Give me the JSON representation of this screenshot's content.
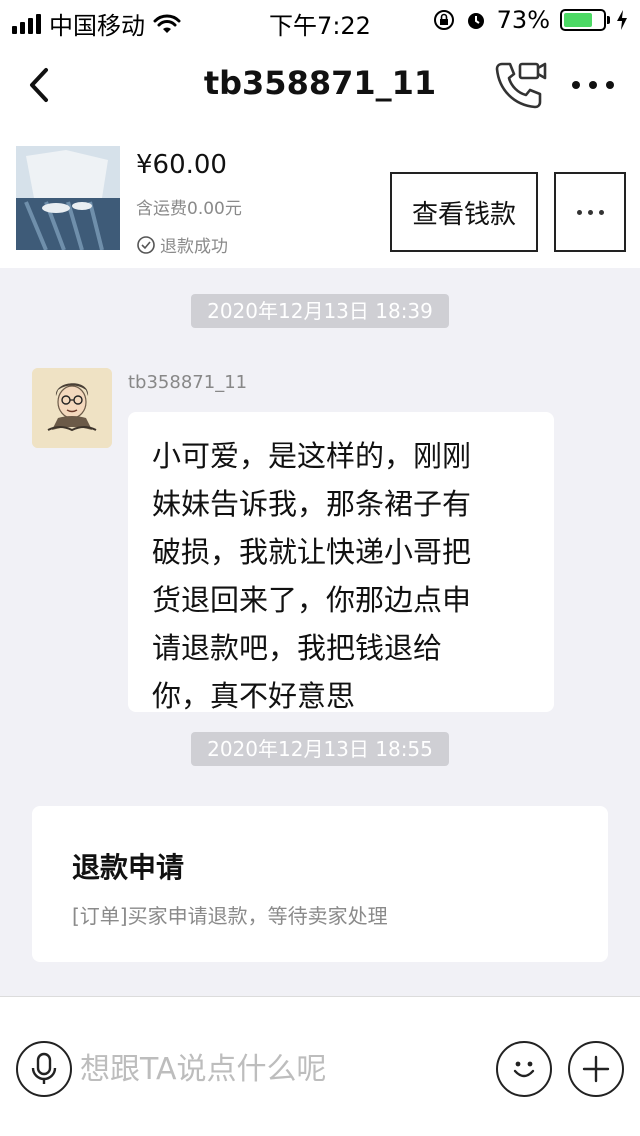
{
  "status_bar": {
    "carrier": "中国移动",
    "time": "下午7:22",
    "battery": "73%",
    "battery_level": 0.73
  },
  "nav": {
    "title": "tb358871_11"
  },
  "order": {
    "price": "¥60.00",
    "shipping": "含运费0.00元",
    "status": "退款成功",
    "view_money_label": "查看钱款"
  },
  "chat": {
    "timestamp_1": "2020年12月13日 18:39",
    "sender": "tb358871_11",
    "message_lines": [
      "小可爱，是这样的，刚刚",
      "妹妹告诉我，那条裙子有",
      "破损，我就让快递小哥把",
      "货退回来了，你那边点申",
      "请退款吧，我把钱退给",
      "你，真不好意思"
    ],
    "timestamp_2": "2020年12月13日 18:55",
    "refund_card": {
      "title": "退款申请",
      "description": "[订单]买家申请退款，等待卖家处理"
    }
  },
  "input": {
    "placeholder": "想跟TA说点什么呢"
  },
  "colors": {
    "background": "#f1f1f6",
    "battery_green": "#4cd964",
    "timestamp_bg": "#cfcfd4"
  }
}
